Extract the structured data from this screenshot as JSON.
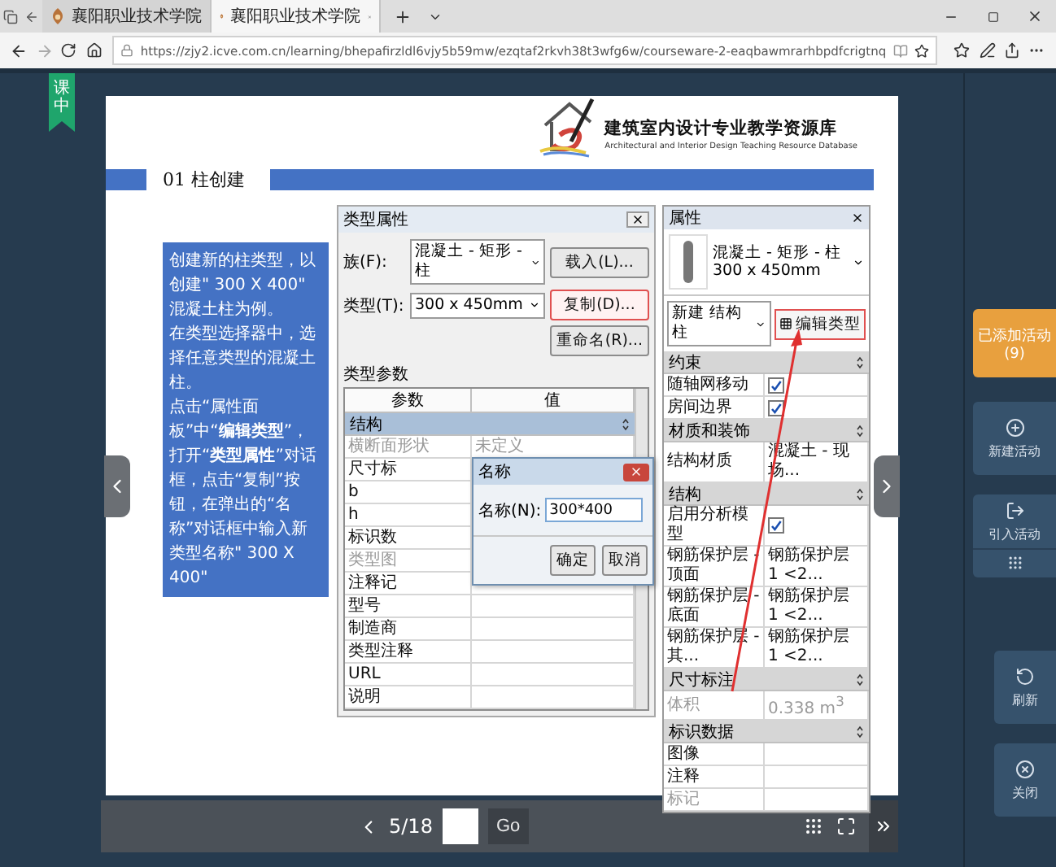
{
  "browser": {
    "tabs": [
      {
        "title": "襄阳职业技术学院",
        "selected": false
      },
      {
        "title": "襄阳职业技术学院",
        "selected": true
      }
    ],
    "url": "https://zjy2.icve.com.cn/learning/bhepafirzldl6vjy5b59mw/ezqtaf2rkvh38t3wfg6w/courseware-2-eaqbawmrarhbpdfcrigtnq"
  },
  "phase_tag": "课中",
  "slide": {
    "logo": {
      "title": "建筑室内设计专业教学资源库",
      "subtitle": "Architectural and Interior Design Teaching Resource Database"
    },
    "section_title": "01 柱创建",
    "instructions": [
      "创建新的柱类型，以创建\" 300 X 400\" 混凝土柱为例。",
      "在类型选择器中，选择任意类型的混凝土柱。",
      "点击“属性面板”中“**编辑类型**”，打开“**类型属性**”对话框，点击“复制”按钮，在弹出的“名称”对话框中输入新类型名称\" 300  X 400\""
    ],
    "type_dialog": {
      "title": "类型属性",
      "fields": [
        {
          "label": "族(F):",
          "value": "混凝土 - 矩形 - 柱"
        },
        {
          "label": "类型(T):",
          "value": "300 x 450mm"
        }
      ],
      "buttons": [
        {
          "label": "载入(L)...",
          "highlighted": false
        },
        {
          "label": "复制(D)...",
          "highlighted": true
        },
        {
          "label": "重命名(R)...",
          "highlighted": false
        }
      ],
      "params_label": "类型参数",
      "columns": [
        "参数",
        "值"
      ],
      "rows": [
        {
          "kind": "group",
          "label": "结构"
        },
        {
          "kind": "row",
          "name": "横断面形状",
          "value": "未定义",
          "dimmed": true
        },
        {
          "kind": "row",
          "name": "尺寸标",
          "dimmed": false
        },
        {
          "kind": "row",
          "name": "b",
          "dimmed": false
        },
        {
          "kind": "row",
          "name": "h",
          "dimmed": false
        },
        {
          "kind": "row",
          "name": "标识数",
          "dimmed": false
        },
        {
          "kind": "row",
          "name": "类型图",
          "dimmed": true
        },
        {
          "kind": "row",
          "name": "注释记",
          "dimmed": false
        },
        {
          "kind": "row",
          "name": "型号",
          "dimmed": false
        },
        {
          "kind": "row",
          "name": "制造商",
          "dimmed": false
        },
        {
          "kind": "row",
          "name": "类型注释",
          "dimmed": false
        },
        {
          "kind": "row",
          "name": "URL",
          "dimmed": false
        },
        {
          "kind": "row",
          "name": "说明",
          "dimmed": false
        }
      ]
    },
    "name_dialog": {
      "title": "名称",
      "label": "名称(N):",
      "value": "300*400",
      "buttons": [
        "确定",
        "取消"
      ]
    },
    "properties": {
      "title": "属性",
      "type_name": "混凝土 - 矩形 - 柱",
      "type_size": "300 x 450mm",
      "instance": "新建 结构柱",
      "edit_type": {
        "label": "编辑类型",
        "highlighted": true
      },
      "rows": [
        {
          "kind": "group",
          "label": "约束"
        },
        {
          "kind": "check",
          "name": "随轴网移动",
          "checked": true
        },
        {
          "kind": "check",
          "name": "房间边界",
          "checked": true
        },
        {
          "kind": "group",
          "label": "材质和装饰"
        },
        {
          "kind": "row",
          "name": "结构材质",
          "value": "混凝土 - 现场...",
          "dimmed": false
        },
        {
          "kind": "group",
          "label": "结构"
        },
        {
          "kind": "check",
          "name": "启用分析模型",
          "checked": true
        },
        {
          "kind": "row",
          "name": "钢筋保护层 - 顶面",
          "value": "钢筋保护层 1 <2...",
          "dimmed": false
        },
        {
          "kind": "row",
          "name": "钢筋保护层 - 底面",
          "value": "钢筋保护层 1 <2...",
          "dimmed": false
        },
        {
          "kind": "row",
          "name": "钢筋保护层 - 其...",
          "value": "钢筋保护层 1 <2...",
          "dimmed": false
        },
        {
          "kind": "group",
          "label": "尺寸标注"
        },
        {
          "kind": "row",
          "name": "体积",
          "value": "0.338 m$^{3}$",
          "dimmed": true
        },
        {
          "kind": "group",
          "label": "标识数据"
        },
        {
          "kind": "row",
          "name": "图像",
          "dimmed": false
        },
        {
          "kind": "row",
          "name": "注释",
          "dimmed": false
        },
        {
          "kind": "row",
          "name": "标记",
          "dimmed": true
        }
      ]
    }
  },
  "pager": {
    "page": "5/18",
    "go": "Go"
  },
  "sidebar": {
    "added": {
      "label": "已添加活动",
      "count": "(9)"
    },
    "actions": [
      {
        "kind": "new",
        "label": "新建活动"
      },
      {
        "kind": "import",
        "label": "引入活动"
      }
    ],
    "tools": [
      {
        "kind": "refresh",
        "label": "刷新"
      },
      {
        "kind": "close",
        "label": "关闭"
      }
    ]
  }
}
